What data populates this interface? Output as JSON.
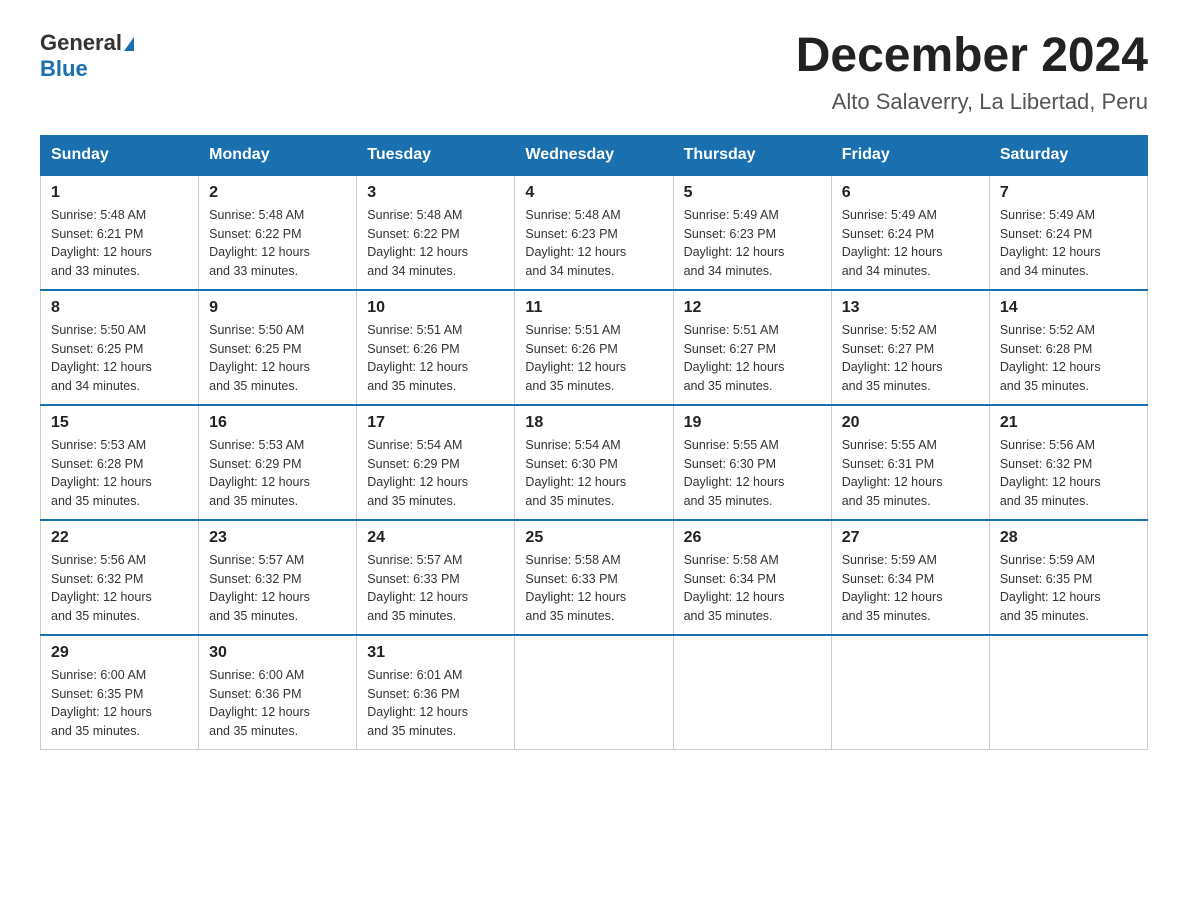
{
  "logo": {
    "line1": "General",
    "line2": "Blue"
  },
  "title": "December 2024",
  "subtitle": "Alto Salaverry, La Libertad, Peru",
  "days_of_week": [
    "Sunday",
    "Monday",
    "Tuesday",
    "Wednesday",
    "Thursday",
    "Friday",
    "Saturday"
  ],
  "weeks": [
    [
      {
        "day": "1",
        "info": "Sunrise: 5:48 AM\nSunset: 6:21 PM\nDaylight: 12 hours\nand 33 minutes."
      },
      {
        "day": "2",
        "info": "Sunrise: 5:48 AM\nSunset: 6:22 PM\nDaylight: 12 hours\nand 33 minutes."
      },
      {
        "day": "3",
        "info": "Sunrise: 5:48 AM\nSunset: 6:22 PM\nDaylight: 12 hours\nand 34 minutes."
      },
      {
        "day": "4",
        "info": "Sunrise: 5:48 AM\nSunset: 6:23 PM\nDaylight: 12 hours\nand 34 minutes."
      },
      {
        "day": "5",
        "info": "Sunrise: 5:49 AM\nSunset: 6:23 PM\nDaylight: 12 hours\nand 34 minutes."
      },
      {
        "day": "6",
        "info": "Sunrise: 5:49 AM\nSunset: 6:24 PM\nDaylight: 12 hours\nand 34 minutes."
      },
      {
        "day": "7",
        "info": "Sunrise: 5:49 AM\nSunset: 6:24 PM\nDaylight: 12 hours\nand 34 minutes."
      }
    ],
    [
      {
        "day": "8",
        "info": "Sunrise: 5:50 AM\nSunset: 6:25 PM\nDaylight: 12 hours\nand 34 minutes."
      },
      {
        "day": "9",
        "info": "Sunrise: 5:50 AM\nSunset: 6:25 PM\nDaylight: 12 hours\nand 35 minutes."
      },
      {
        "day": "10",
        "info": "Sunrise: 5:51 AM\nSunset: 6:26 PM\nDaylight: 12 hours\nand 35 minutes."
      },
      {
        "day": "11",
        "info": "Sunrise: 5:51 AM\nSunset: 6:26 PM\nDaylight: 12 hours\nand 35 minutes."
      },
      {
        "day": "12",
        "info": "Sunrise: 5:51 AM\nSunset: 6:27 PM\nDaylight: 12 hours\nand 35 minutes."
      },
      {
        "day": "13",
        "info": "Sunrise: 5:52 AM\nSunset: 6:27 PM\nDaylight: 12 hours\nand 35 minutes."
      },
      {
        "day": "14",
        "info": "Sunrise: 5:52 AM\nSunset: 6:28 PM\nDaylight: 12 hours\nand 35 minutes."
      }
    ],
    [
      {
        "day": "15",
        "info": "Sunrise: 5:53 AM\nSunset: 6:28 PM\nDaylight: 12 hours\nand 35 minutes."
      },
      {
        "day": "16",
        "info": "Sunrise: 5:53 AM\nSunset: 6:29 PM\nDaylight: 12 hours\nand 35 minutes."
      },
      {
        "day": "17",
        "info": "Sunrise: 5:54 AM\nSunset: 6:29 PM\nDaylight: 12 hours\nand 35 minutes."
      },
      {
        "day": "18",
        "info": "Sunrise: 5:54 AM\nSunset: 6:30 PM\nDaylight: 12 hours\nand 35 minutes."
      },
      {
        "day": "19",
        "info": "Sunrise: 5:55 AM\nSunset: 6:30 PM\nDaylight: 12 hours\nand 35 minutes."
      },
      {
        "day": "20",
        "info": "Sunrise: 5:55 AM\nSunset: 6:31 PM\nDaylight: 12 hours\nand 35 minutes."
      },
      {
        "day": "21",
        "info": "Sunrise: 5:56 AM\nSunset: 6:32 PM\nDaylight: 12 hours\nand 35 minutes."
      }
    ],
    [
      {
        "day": "22",
        "info": "Sunrise: 5:56 AM\nSunset: 6:32 PM\nDaylight: 12 hours\nand 35 minutes."
      },
      {
        "day": "23",
        "info": "Sunrise: 5:57 AM\nSunset: 6:32 PM\nDaylight: 12 hours\nand 35 minutes."
      },
      {
        "day": "24",
        "info": "Sunrise: 5:57 AM\nSunset: 6:33 PM\nDaylight: 12 hours\nand 35 minutes."
      },
      {
        "day": "25",
        "info": "Sunrise: 5:58 AM\nSunset: 6:33 PM\nDaylight: 12 hours\nand 35 minutes."
      },
      {
        "day": "26",
        "info": "Sunrise: 5:58 AM\nSunset: 6:34 PM\nDaylight: 12 hours\nand 35 minutes."
      },
      {
        "day": "27",
        "info": "Sunrise: 5:59 AM\nSunset: 6:34 PM\nDaylight: 12 hours\nand 35 minutes."
      },
      {
        "day": "28",
        "info": "Sunrise: 5:59 AM\nSunset: 6:35 PM\nDaylight: 12 hours\nand 35 minutes."
      }
    ],
    [
      {
        "day": "29",
        "info": "Sunrise: 6:00 AM\nSunset: 6:35 PM\nDaylight: 12 hours\nand 35 minutes."
      },
      {
        "day": "30",
        "info": "Sunrise: 6:00 AM\nSunset: 6:36 PM\nDaylight: 12 hours\nand 35 minutes."
      },
      {
        "day": "31",
        "info": "Sunrise: 6:01 AM\nSunset: 6:36 PM\nDaylight: 12 hours\nand 35 minutes."
      },
      {
        "day": "",
        "info": ""
      },
      {
        "day": "",
        "info": ""
      },
      {
        "day": "",
        "info": ""
      },
      {
        "day": "",
        "info": ""
      }
    ]
  ]
}
